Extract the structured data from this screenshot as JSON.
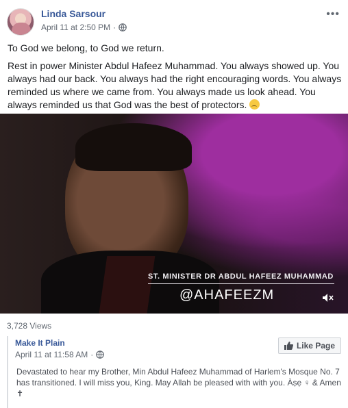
{
  "post": {
    "author": "Linda Sarsour",
    "timestamp": "April 11 at 2:50 PM",
    "privacy_icon": "globe-icon",
    "more_icon": "•••",
    "text_line_1": "To God we belong, to God we return.",
    "text_line_2": "Rest in power Minister Abdul Hafeez Muhammad. You always showed up. You always had our back. You always had the right encouraging words. You always reminded us where we came from. You always made us look ahead. You always reminded us that God was the best of protectors.",
    "emoji": "sad-face-emoji"
  },
  "video": {
    "caption": "ST. MINISTER DR ABDUL HAFEEZ MUHAMMAD",
    "handle": "@AHAFEEZM",
    "mute_icon": "speaker-muted-icon"
  },
  "stats": {
    "views": "3,728 Views"
  },
  "shared_post": {
    "page_name": "Make It Plain",
    "timestamp": "April 11 at 11:58 AM",
    "privacy_icon": "globe-icon",
    "like_button_label": "Like Page",
    "text": "Devastated to hear my Brother, Min Abdul Hafeez Muhammad of Harlem's Mosque No. 7 has transitioned. I will miss you, King. May Allah be pleased with with you. Àṣẹ ♀ & Amen ✝"
  },
  "colors": {
    "link_blue": "#385898",
    "meta_gray": "#606770",
    "text": "#1c1e21"
  }
}
